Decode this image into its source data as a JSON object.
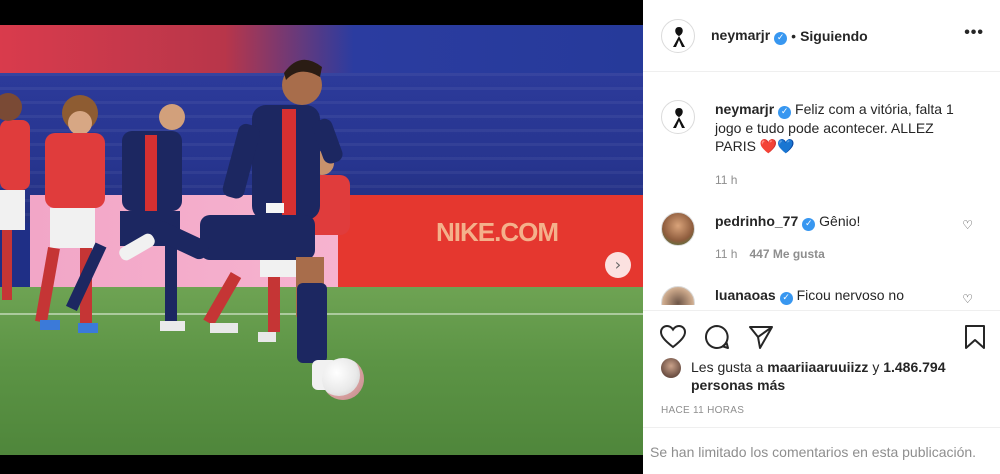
{
  "post": {
    "author": "neymarjr",
    "separator": "•",
    "follow_status": "Siguiendo",
    "more_label": "•••"
  },
  "comments": [
    {
      "user": "neymarjr",
      "verified": true,
      "text": "Feliz com a vitória, falta 1 jogo e tudo pode acontecer. ALLEZ PARIS ❤️💙",
      "time": "11 h"
    },
    {
      "user": "pedrinho_77",
      "verified": true,
      "text": "Gênio!",
      "time": "11 h",
      "likes": "447 Me gusta"
    },
    {
      "user": "luanaoas",
      "verified": true,
      "text": "Ficou nervoso no"
    }
  ],
  "likes": {
    "prefix": "Les gusta a",
    "first_user": "maariiaaruuiizz",
    "connector": "y",
    "count_text": "1.486.794 personas más"
  },
  "timestamp": "HACE 11 HORAS",
  "comments_limited": "Se han limitado los comentarios en esta publicación.",
  "photo": {
    "board_text": "NIKE.COM",
    "carousel_next": "›",
    "slide_count": 2,
    "active_slide": 1
  },
  "icons": [
    "like-heart-icon",
    "comment-icon",
    "share-icon",
    "save-bookmark-icon",
    "verified-icon",
    "more-options-icon",
    "chevron-right-icon"
  ],
  "colors": {
    "verified": "#3897f0",
    "text_primary": "#262626",
    "text_secondary": "#8e8e8e",
    "border": "#efefef"
  }
}
